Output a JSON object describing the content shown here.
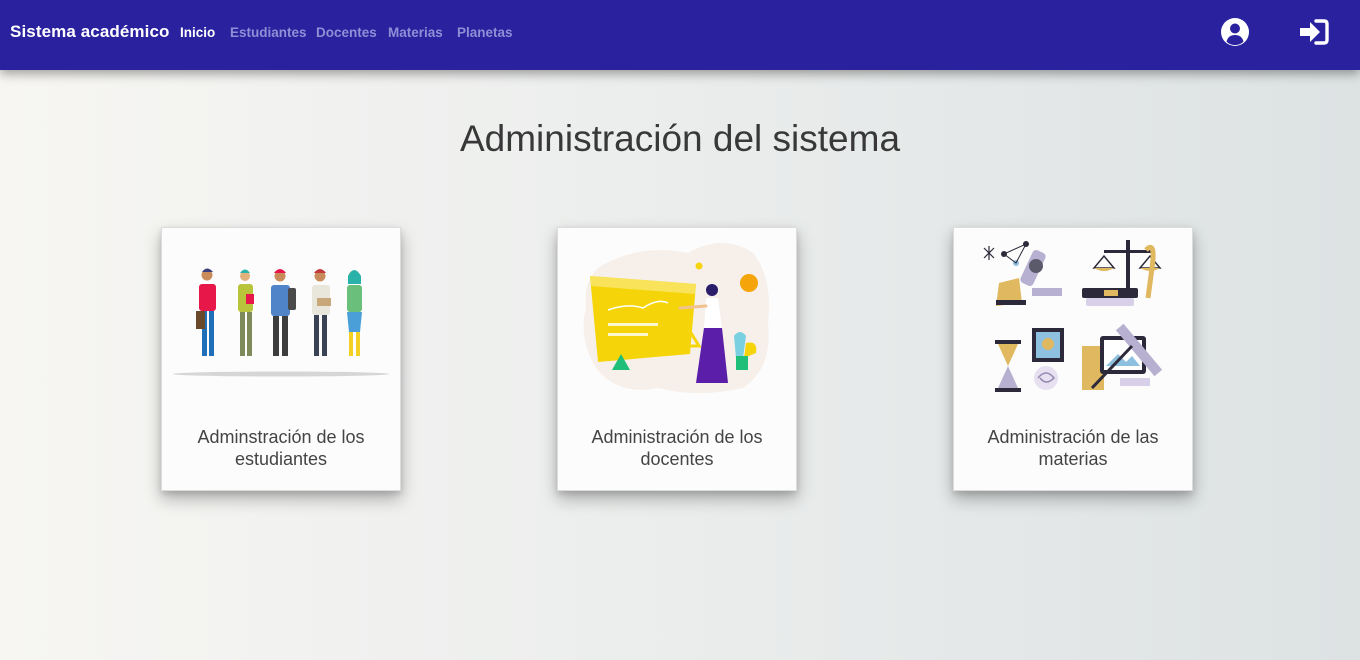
{
  "app": {
    "brand": "Sistema académico"
  },
  "nav": {
    "items": [
      {
        "label": "Inicio",
        "active": true
      },
      {
        "label": "Estudiantes",
        "active": false
      },
      {
        "label": "Docentes",
        "active": false
      },
      {
        "label": "Materias",
        "active": false
      },
      {
        "label": "Planetas",
        "active": false
      }
    ],
    "icons": [
      "user-circle-icon",
      "sign-in-icon"
    ]
  },
  "main": {
    "title": "Administración del sistema",
    "cards": [
      {
        "label": "Adminstración de los estudiantes",
        "image": "students-group-illustration"
      },
      {
        "label": "Administración de los docentes",
        "image": "teacher-presentation-illustration"
      },
      {
        "label": "Administración de las materias",
        "image": "subjects-collage-illustration"
      }
    ]
  },
  "colors": {
    "navbar": "#2a219f",
    "nav_active": "#ffffff",
    "nav_inactive": "#8f8fd6",
    "title_text": "#383838"
  }
}
